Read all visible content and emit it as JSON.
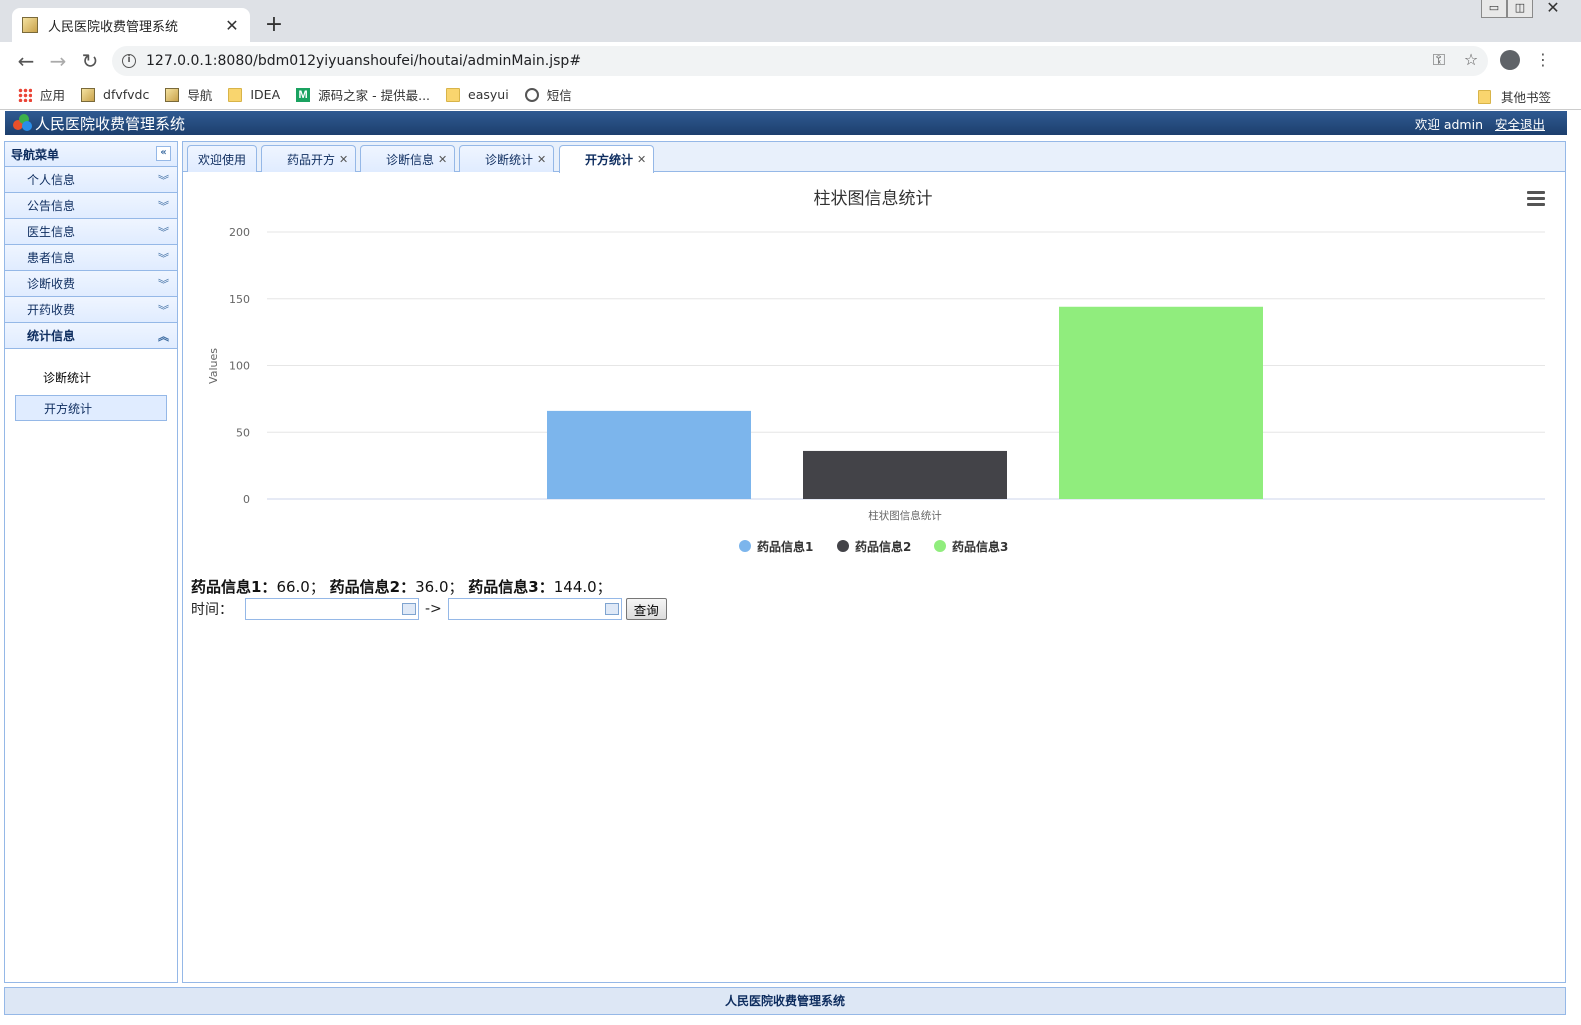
{
  "browser": {
    "tab_title": "人民医院收费管理系统",
    "tab_close": "✕",
    "new_tab": "+",
    "url": "127.0.0.1:8080/bdm012yiyuanshoufei/houtai/adminMain.jsp#",
    "bookmarks": [
      {
        "label": "应用",
        "icon": "apps-icon"
      },
      {
        "label": "dfvfvdc",
        "icon": "image-icon"
      },
      {
        "label": "导航",
        "icon": "image-icon"
      },
      {
        "label": "IDEA",
        "icon": "folder-icon"
      },
      {
        "label": "源码之家 - 提供最...",
        "icon": "m-icon"
      },
      {
        "label": "easyui",
        "icon": "folder-icon"
      },
      {
        "label": "短信",
        "icon": "globe-icon"
      }
    ],
    "other_bookmarks": "其他书签"
  },
  "app": {
    "title": "人民医院收费管理系统",
    "welcome": "欢迎 admin",
    "logout": "安全退出"
  },
  "sidebar": {
    "title": "导航菜单",
    "items": [
      {
        "label": "个人信息"
      },
      {
        "label": "公告信息"
      },
      {
        "label": "医生信息"
      },
      {
        "label": "患者信息"
      },
      {
        "label": "诊断收费"
      },
      {
        "label": "开药收费"
      },
      {
        "label": "统计信息"
      }
    ],
    "sub_items": [
      {
        "label": "诊断统计"
      },
      {
        "label": "开方统计"
      }
    ]
  },
  "tabs": [
    {
      "label": "欢迎使用"
    },
    {
      "label": "药品开方"
    },
    {
      "label": "诊断信息"
    },
    {
      "label": "诊断统计"
    },
    {
      "label": "开方统计"
    }
  ],
  "chart_data": {
    "type": "bar",
    "title": "柱状图信息统计",
    "xlabel": "",
    "ylabel": "Values",
    "categories": [
      "柱状图信息统计"
    ],
    "ylim": [
      0,
      200
    ],
    "yticks": [
      0,
      50,
      100,
      150,
      200
    ],
    "grid": true,
    "legend_position": "bottom",
    "series": [
      {
        "name": "药品信息1",
        "values": [
          66.0
        ],
        "color": "#7cb5ec"
      },
      {
        "name": "药品信息2",
        "values": [
          36.0
        ],
        "color": "#434348"
      },
      {
        "name": "药品信息3",
        "values": [
          144.0
        ],
        "color": "#90ed7d"
      }
    ]
  },
  "summary": {
    "s1_label": "药品信息1：",
    "s1_value": "66.0；",
    "s2_label": "药品信息2：",
    "s2_value": "36.0；",
    "s3_label": "药品信息3：",
    "s3_value": "144.0；"
  },
  "filter": {
    "time_label": "时间：",
    "arrow": "->",
    "start_value": "",
    "end_value": "",
    "query_button": "查询"
  },
  "footer": {
    "text": "人民医院收费管理系统"
  }
}
